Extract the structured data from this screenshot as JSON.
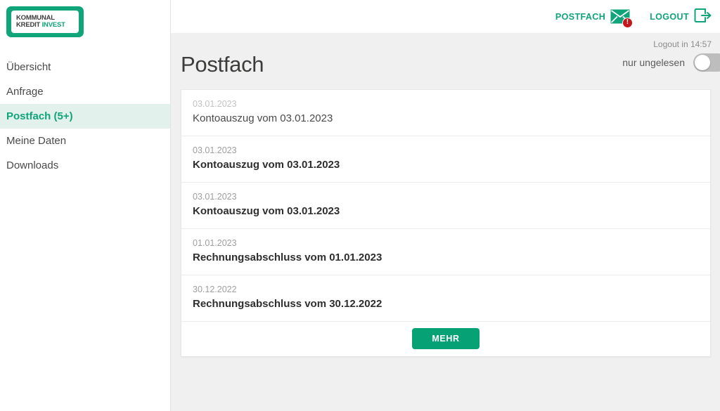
{
  "brand": {
    "logo_line1": "KOMMUNAL",
    "logo_line2_dark": "KREDIT ",
    "logo_line2_accent": "INVEST",
    "accent_color": "#0fa47a",
    "button_green": "#06a175",
    "active_nav_bg": "#e3f1ec",
    "badge_red": "#c4161c"
  },
  "header": {
    "postfach_label": "POSTFACH",
    "postfach_icon": "envelope-icon",
    "badge_text": "!",
    "badge_count": 1,
    "logout_label": "LOGOUT",
    "logout_icon": "logout-icon"
  },
  "sidebar": {
    "items": [
      {
        "label": "Übersicht",
        "active": false
      },
      {
        "label": "Anfrage",
        "active": false
      },
      {
        "label": "Postfach (5+)",
        "active": true
      },
      {
        "label": "Meine Daten",
        "active": false
      },
      {
        "label": "Downloads",
        "active": false
      }
    ]
  },
  "main": {
    "session_timer": "Logout in 14:57",
    "page_title": "Postfach",
    "filter_toggle_label": "nur ungelesen",
    "filter_toggle_state": "off",
    "messages": [
      {
        "date": "03.01.2023",
        "title": "Kontoauszug vom 03.01.2023",
        "unread": false
      },
      {
        "date": "03.01.2023",
        "title": "Kontoauszug vom 03.01.2023",
        "unread": true
      },
      {
        "date": "03.01.2023",
        "title": "Kontoauszug vom 03.01.2023",
        "unread": true
      },
      {
        "date": "01.01.2023",
        "title": "Rechnungsabschluss vom 01.01.2023",
        "unread": true
      },
      {
        "date": "30.12.2022",
        "title": "Rechnungsabschluss vom 30.12.2022",
        "unread": true
      }
    ],
    "more_button_label": "MEHR"
  }
}
